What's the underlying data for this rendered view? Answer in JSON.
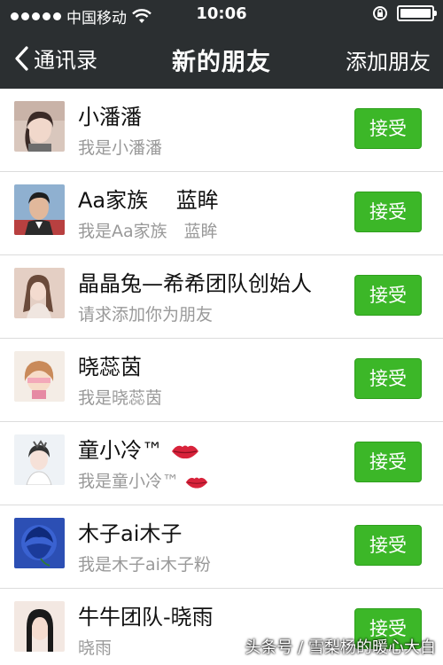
{
  "status_bar": {
    "carrier": "中国移动",
    "time": "10:06",
    "battery_level": 1.0
  },
  "nav": {
    "back_label": "通讯录",
    "title": "新的朋友",
    "action_label": "添加朋友"
  },
  "accept_label": "接受",
  "requests": [
    {
      "name": "小潘潘",
      "message": "我是小潘潘",
      "avatar_colors": [
        "#d9c7bd",
        "#3a2a26"
      ]
    },
    {
      "name": "Aa家族　 蓝眸",
      "message": "我是Aa家族　蓝眸",
      "avatar_colors": [
        "#8fb0d0",
        "#2b2b2b"
      ]
    },
    {
      "name": "晶晶兔—希希团队创始人",
      "message": "请求添加你为朋友",
      "avatar_colors": [
        "#e4cfc4",
        "#6a4a3a"
      ]
    },
    {
      "name": "晓蕊茵",
      "message": "我是晓蕊茵",
      "avatar_colors": [
        "#f4ede6",
        "#c98a5a"
      ]
    },
    {
      "name": "童小冷™",
      "message": "我是童小冷™",
      "has_lips": true,
      "avatar_colors": [
        "#eef2f6",
        "#333333"
      ]
    },
    {
      "name": "木子ai木子",
      "message": "我是木子ai木子粉",
      "avatar_colors": [
        "#2c4fb4",
        "#0f2a7a"
      ]
    },
    {
      "name": "牛牛团队-晓雨",
      "message": "晓雨",
      "avatar_colors": [
        "#f3e8e2",
        "#1a1a1a"
      ]
    }
  ],
  "watermark": "头条号 / 雪梨杨的暖心大白",
  "colors": {
    "nav_bg": "#2b2f31",
    "accept_green": "#3cb728",
    "secondary_text": "#999999"
  }
}
